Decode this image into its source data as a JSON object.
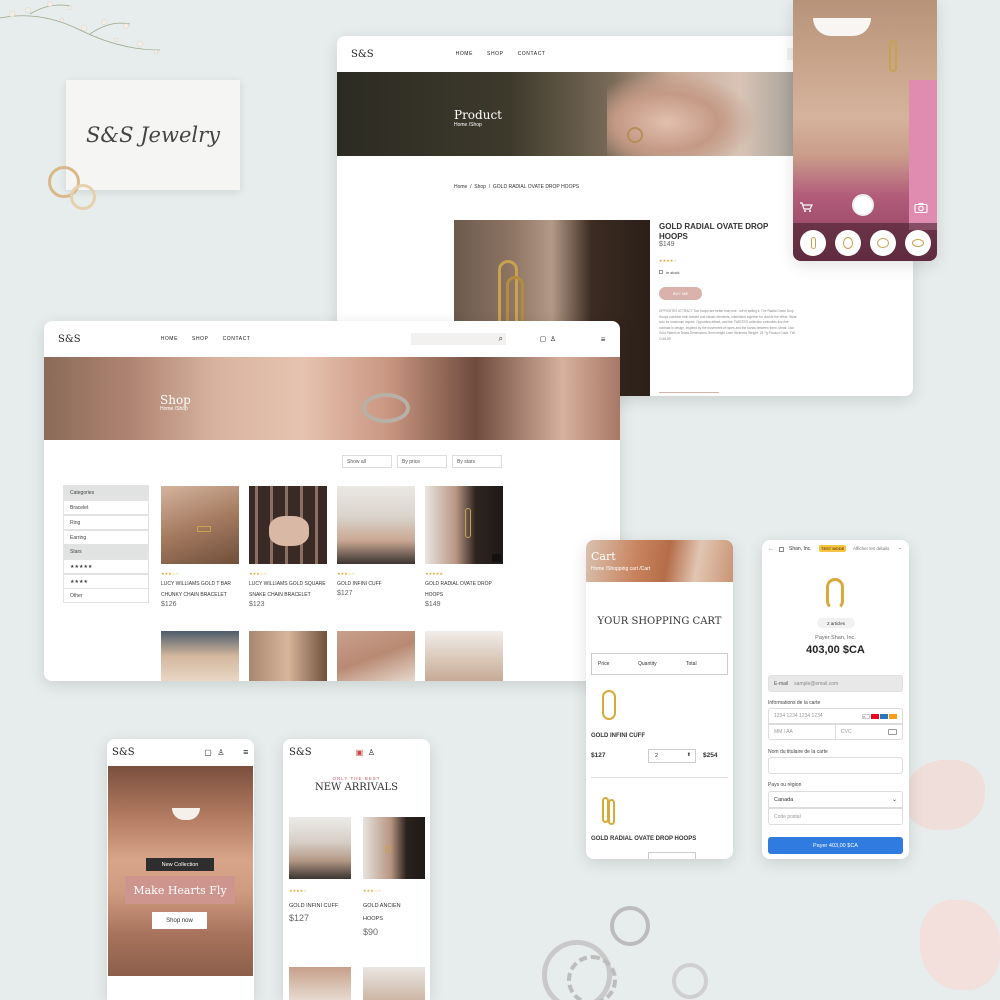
{
  "brand": {
    "logo": "S&S",
    "card_script": "S&S Jewelry"
  },
  "nav": {
    "home": "HOME",
    "shop": "SHOP",
    "contact": "CONTACT"
  },
  "product_page": {
    "hero_title": "Product",
    "hero_crumb": "Home /Shop",
    "breadcrumb": "Home  /  Shop  /  GOLD RADIAL OVATE DROP HOOPS",
    "name": "GOLD RADIAL OVATE DROP HOOPS",
    "price": "$149",
    "stock": "in stock",
    "button": "BUY ME",
    "description": "OPPOSITES ATTRACT Two hoops are better than one - we're calling it. The Radial Ovate Drop Hoops combine both twisted and classic elements, interlinked together for double the effect. Wear solo for maximum impact. Opposites attract, and the TWISTED collection embodies this fine contrast in design, inspired by the movement of ropes and the bonds between them. Metal: 14ct Gold Plated on Brass Dimensions: 5mm height 1mm thickness Weight: 25.7g Product Code: TW-O-66-99"
  },
  "shop_page": {
    "hero_title": "Shop",
    "hero_crumb": "Home /Shop",
    "filters": [
      "Show all",
      "By price",
      "By stars"
    ],
    "categories_title": "Categories",
    "categories": [
      "Bracelet",
      "Ring",
      "Earring"
    ],
    "stars_title": "Stars",
    "star_rows": [
      "★★★★★",
      "★★★★"
    ],
    "other": "Other",
    "products": [
      {
        "stars": "★★★☆☆",
        "name1": "LUCY WILLIAMS GOLD T BAR",
        "name2": "CHUNKY CHAIN BRACELET",
        "price": "$126"
      },
      {
        "stars": "★★★☆☆",
        "name1": "LUCY WILLIAMS GOLD SQUARE",
        "name2": "SNAKE CHAIN BRACELET",
        "price": "$123"
      },
      {
        "stars": "★★★☆☆",
        "name1": "GOLD INFINI CUFF",
        "name2": "",
        "price": "$127"
      },
      {
        "stars": "★★★★★",
        "name1": "GOLD RADIAL OVATE DROP",
        "name2": "HOOPS",
        "price": "$149"
      }
    ]
  },
  "mobile_home": {
    "badge": "New Collection",
    "headline": "Make Hearts Fly",
    "cta": "Shop now"
  },
  "mobile_arrivals": {
    "kicker": "ONLY THE BEST",
    "title": "NEW ARRIVALS",
    "items": [
      {
        "stars": "★★★★☆",
        "name1": "GOLD INFINI CUFF",
        "name2": "",
        "price": "$127"
      },
      {
        "stars": "★★★☆☆",
        "name1": "GOLD ANCIEN",
        "name2": "HOOPS",
        "price": "$90"
      }
    ]
  },
  "cart": {
    "hero_title": "Cart",
    "hero_crumb": "Home /Shopping cart /Cart",
    "title": "YOUR SHOPPING CART",
    "cols": [
      "Price",
      "Quantity",
      "Total"
    ],
    "item1": {
      "name": "GOLD INFINI CUFF",
      "price": "$127",
      "qty": "2",
      "total": "$254"
    },
    "item2": {
      "name": "GOLD RADIAL OVATE DROP HOOPS"
    }
  },
  "checkout": {
    "merchant": "Shan, Inc.",
    "test_badge": "TEST MODE",
    "details": "Afficher les détails",
    "articles": "2 articles",
    "payer_label": "Payer Shan, Inc.",
    "amount": "403,00 $CA",
    "email_label": "E-mail",
    "email_placeholder": "sample@email.com",
    "card_info": "Informations de la carte",
    "card_number": "1234 1234 1234 1234",
    "expiry": "MM / AA",
    "cvc": "CVC",
    "holder_label": "Nom du titulaire de la carte",
    "country_label": "Pays ou région",
    "country": "Canada",
    "postal": "Code postal",
    "pay_button": "Payer 403,00 $CA"
  },
  "colors": {
    "background": "#e6edec",
    "accent_pink": "#d4a39c",
    "stripe_blue": "#2f7be0",
    "stars": "#e0a93b",
    "gold": "#d9a93a"
  }
}
